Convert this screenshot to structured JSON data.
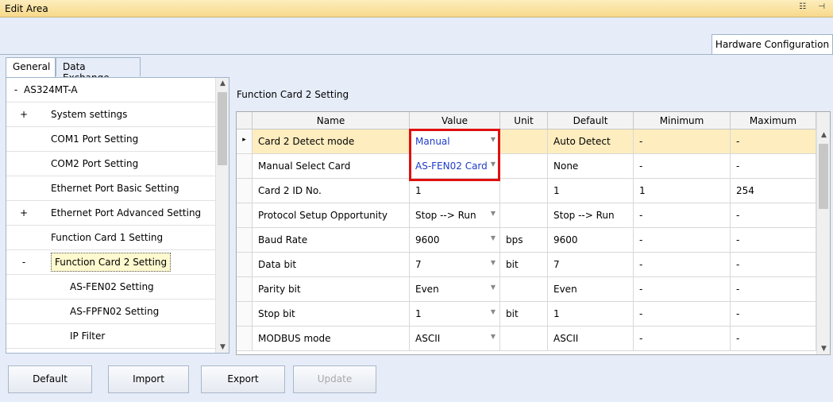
{
  "window": {
    "title": "Edit Area",
    "icons": "☷ ⊣"
  },
  "top_tab": "Hardware Configuration",
  "tabs": [
    "General",
    "Data Exchange"
  ],
  "tree": [
    {
      "sign": "-",
      "label": "AS324MT-A"
    },
    {
      "sign": "+",
      "label": "System settings"
    },
    {
      "sign": "",
      "label": "COM1 Port Setting"
    },
    {
      "sign": "",
      "label": "COM2 Port Setting"
    },
    {
      "sign": "",
      "label": "Ethernet Port Basic Setting"
    },
    {
      "sign": "+",
      "label": "Ethernet Port Advanced Setting"
    },
    {
      "sign": "",
      "label": "Function Card 1 Setting"
    },
    {
      "sign": "-",
      "label": "Function Card 2 Setting"
    },
    {
      "sign": "",
      "label": "AS-FEN02 Setting"
    },
    {
      "sign": "",
      "label": "AS-FPFN02 Setting"
    },
    {
      "sign": "",
      "label": "IP Filter"
    }
  ],
  "section_title": "Function Card 2 Setting",
  "grid": {
    "headers": [
      "Name",
      "Value",
      "Unit",
      "Default",
      "Minimum",
      "Maximum"
    ],
    "rows": [
      [
        "Card 2 Detect mode",
        "Manual",
        "",
        "Auto Detect",
        "-",
        "-"
      ],
      [
        "Manual Select Card",
        "AS-FEN02 Card",
        "",
        "None",
        "-",
        "-"
      ],
      [
        "Card 2 ID No.",
        "1",
        "",
        "1",
        "1",
        "254"
      ],
      [
        "Protocol Setup Opportunity",
        "Stop --> Run",
        "",
        "Stop --> Run",
        "-",
        "-"
      ],
      [
        "Baud Rate",
        "9600",
        "bps",
        "9600",
        "-",
        "-"
      ],
      [
        "Data bit",
        "7",
        "bit",
        "7",
        "-",
        "-"
      ],
      [
        "Parity bit",
        "Even",
        "",
        "Even",
        "-",
        "-"
      ],
      [
        "Stop bit",
        "1",
        "bit",
        "1",
        "-",
        "-"
      ],
      [
        "MODBUS mode",
        "ASCII",
        "",
        "ASCII",
        "-",
        "-"
      ]
    ],
    "row_marker": "▸"
  },
  "buttons": [
    "Default",
    "Import",
    "Export",
    "Update"
  ]
}
